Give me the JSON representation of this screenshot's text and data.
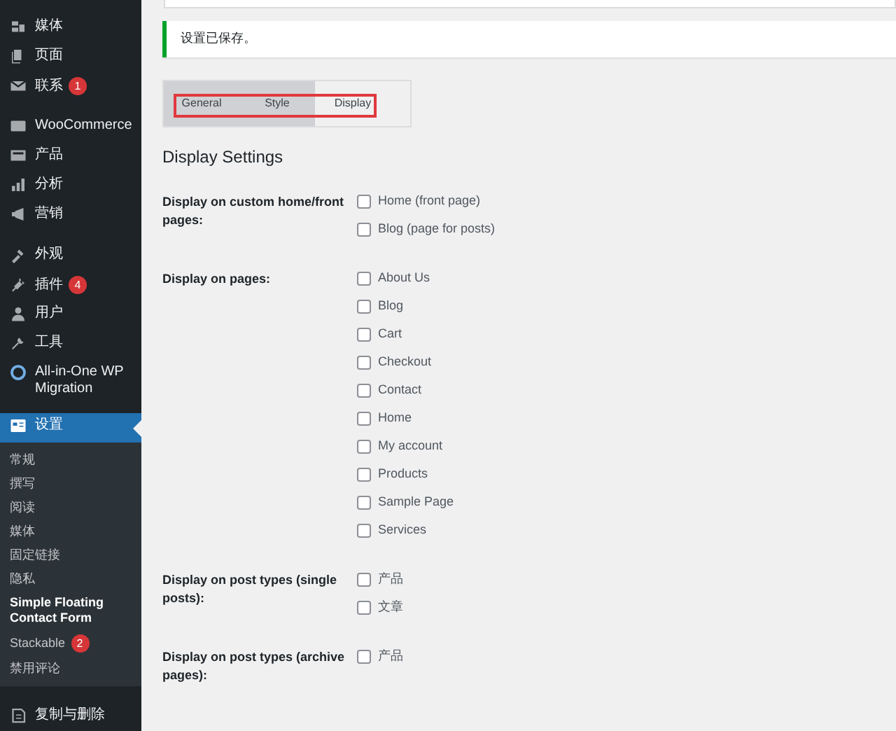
{
  "sidebar": {
    "groups": [
      [
        {
          "label": "媒体"
        },
        {
          "label": "页面"
        },
        {
          "label": "联系",
          "badge": "1"
        }
      ],
      [
        {
          "label": "WooCommerce"
        },
        {
          "label": "产品"
        },
        {
          "label": "分析"
        },
        {
          "label": "营销"
        }
      ],
      [
        {
          "label": "外观"
        },
        {
          "label": "插件",
          "badge": "4"
        },
        {
          "label": "用户"
        },
        {
          "label": "工具"
        },
        {
          "label": "All-in-One WP Migration"
        }
      ],
      [
        {
          "label": "设置",
          "selected": true,
          "submenu": [
            {
              "label": "常规",
              "selected": false
            },
            {
              "label": "撰写",
              "selected": false
            },
            {
              "label": "阅读",
              "selected": false
            },
            {
              "label": "媒体",
              "selected": false
            },
            {
              "label": "固定链接",
              "selected": false
            },
            {
              "label": "隐私",
              "selected": false
            },
            {
              "label": "Simple Floating Contact Form",
              "selected": true
            },
            {
              "label": "Stackable",
              "badge": "2",
              "selected": false
            },
            {
              "label": "禁用评论",
              "selected": false
            }
          ]
        },
        {
          "label": "复制与删除",
          "selected": false
        }
      ]
    ]
  },
  "notice": "设置已保存。",
  "tabs": [
    {
      "label": "General",
      "selected": false
    },
    {
      "label": "Style",
      "selected": false
    },
    {
      "label": "Display",
      "selected": true
    }
  ],
  "section_title": "Display Settings",
  "settings": [
    {
      "label": "Display on custom home/front pages:",
      "options": [
        {
          "label": "Home (front page)",
          "checked": false
        },
        {
          "label": "Blog (page for posts)",
          "checked": false
        }
      ]
    },
    {
      "label": "Display on pages:",
      "options": [
        {
          "label": "About Us",
          "checked": false
        },
        {
          "label": "Blog",
          "checked": false
        },
        {
          "label": "Cart",
          "checked": false
        },
        {
          "label": "Checkout",
          "checked": false
        },
        {
          "label": "Contact",
          "checked": false
        },
        {
          "label": "Home",
          "checked": false
        },
        {
          "label": "My account",
          "checked": false
        },
        {
          "label": "Products",
          "checked": false
        },
        {
          "label": "Sample Page",
          "checked": false
        },
        {
          "label": "Services",
          "checked": false
        }
      ]
    },
    {
      "label": "Display on post types (single posts):",
      "options": [
        {
          "label": "产品",
          "checked": false
        },
        {
          "label": "文章",
          "checked": false
        }
      ]
    },
    {
      "label": "Display on post types (archive pages):",
      "options": [
        {
          "label": "产品",
          "checked": false
        }
      ]
    }
  ]
}
